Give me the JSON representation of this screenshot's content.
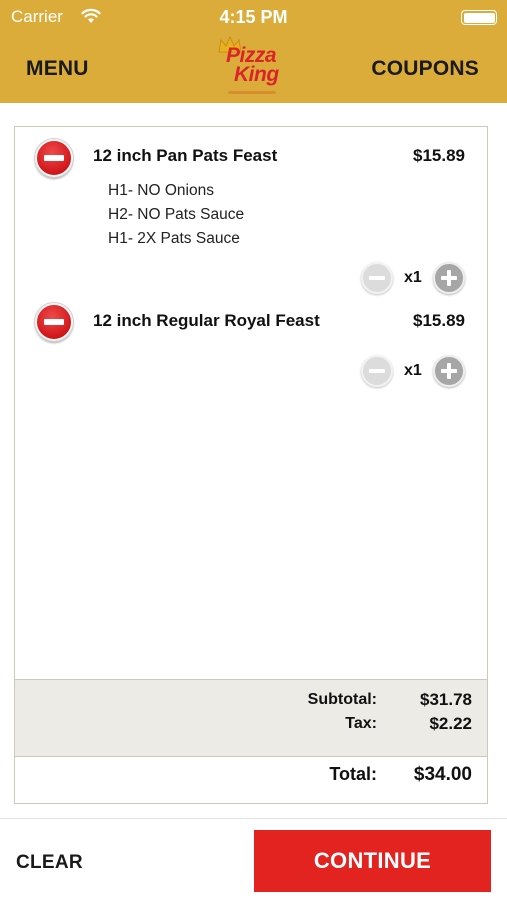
{
  "status_bar": {
    "carrier": "Carrier",
    "time": "4:15 PM"
  },
  "header": {
    "menu_label": "MENU",
    "coupons_label": "COUPONS",
    "logo_line1": "Pizza",
    "logo_line2": "King"
  },
  "cart": {
    "items": [
      {
        "name": "12 inch Pan  Pats Feast",
        "price": "$15.89",
        "modifiers": [
          "H1- NO Onions",
          "H2- NO Pats Sauce",
          "H1- 2X Pats Sauce"
        ],
        "quantity": "x1"
      },
      {
        "name": "12 inch Regular  Royal Feast",
        "price": "$15.89",
        "modifiers": [],
        "quantity": "x1"
      }
    ],
    "summary": {
      "subtotal_label": "Subtotal:",
      "subtotal_value": "$31.78",
      "tax_label": "Tax:",
      "tax_value": "$2.22",
      "total_label": "Total:",
      "total_value": "$34.00"
    }
  },
  "footer": {
    "clear_label": "CLEAR",
    "continue_label": "CONTINUE"
  },
  "colors": {
    "header_bg": "#dcac3b",
    "continue_bg": "#e3231f",
    "summary_bg": "#ecebe5",
    "brand_red": "#d9252a"
  }
}
